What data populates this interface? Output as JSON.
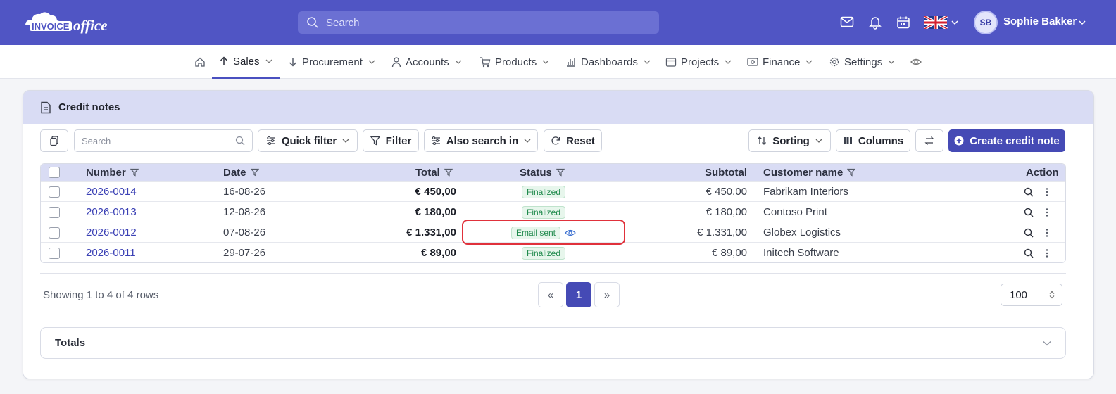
{
  "header": {
    "logo_text": "INVOICEoffice",
    "search_placeholder": "Search",
    "user_initials": "SB",
    "user_name": "Sophie Bakker"
  },
  "nav": {
    "items": [
      {
        "label": "Sales",
        "icon": "arrow-up-icon",
        "active": true
      },
      {
        "label": "Procurement",
        "icon": "arrow-down-icon"
      },
      {
        "label": "Accounts",
        "icon": "person-icon"
      },
      {
        "label": "Products",
        "icon": "cart-icon"
      },
      {
        "label": "Dashboards",
        "icon": "bar-chart-icon"
      },
      {
        "label": "Projects",
        "icon": "calendar-icon"
      },
      {
        "label": "Finance",
        "icon": "money-icon"
      },
      {
        "label": "Settings",
        "icon": "gear-icon"
      }
    ]
  },
  "page": {
    "title": "Credit notes"
  },
  "toolbar": {
    "search_placeholder": "Search",
    "quick_filter": "Quick filter",
    "filter": "Filter",
    "also_search_in": "Also search in",
    "reset": "Reset",
    "sorting": "Sorting",
    "columns": "Columns",
    "create": "Create credit note"
  },
  "table": {
    "columns": [
      "Number",
      "Date",
      "Total",
      "Status",
      "Subtotal",
      "Customer name",
      "Action"
    ],
    "rows": [
      {
        "number": "2026-0014",
        "date": "16-08-26",
        "total": "€ 450,00",
        "status": "Finalized",
        "subtotal": "€ 450,00",
        "customer": "Fabrikam Interiors"
      },
      {
        "number": "2026-0013",
        "date": "12-08-26",
        "total": "€ 180,00",
        "status": "Finalized",
        "subtotal": "€ 180,00",
        "customer": "Contoso Print"
      },
      {
        "number": "2026-0012",
        "date": "07-08-26",
        "total": "€ 1.331,00",
        "status": "Email sent",
        "subtotal": "€ 1.331,00",
        "customer": "Globex Logistics"
      },
      {
        "number": "2026-0011",
        "date": "29-07-26",
        "total": "€ 89,00",
        "status": "Finalized",
        "subtotal": "€ 89,00",
        "customer": "Initech Software"
      }
    ]
  },
  "footer": {
    "showing": "Showing 1 to 4 of 4 rows",
    "prev": "«",
    "page": "1",
    "next": "»",
    "per_page": "100",
    "totals": "Totals"
  },
  "colors": {
    "brand": "#5055c4",
    "primary_button": "#454ab5",
    "status_green": "#1f8a4c",
    "highlight": "#e0313b"
  }
}
